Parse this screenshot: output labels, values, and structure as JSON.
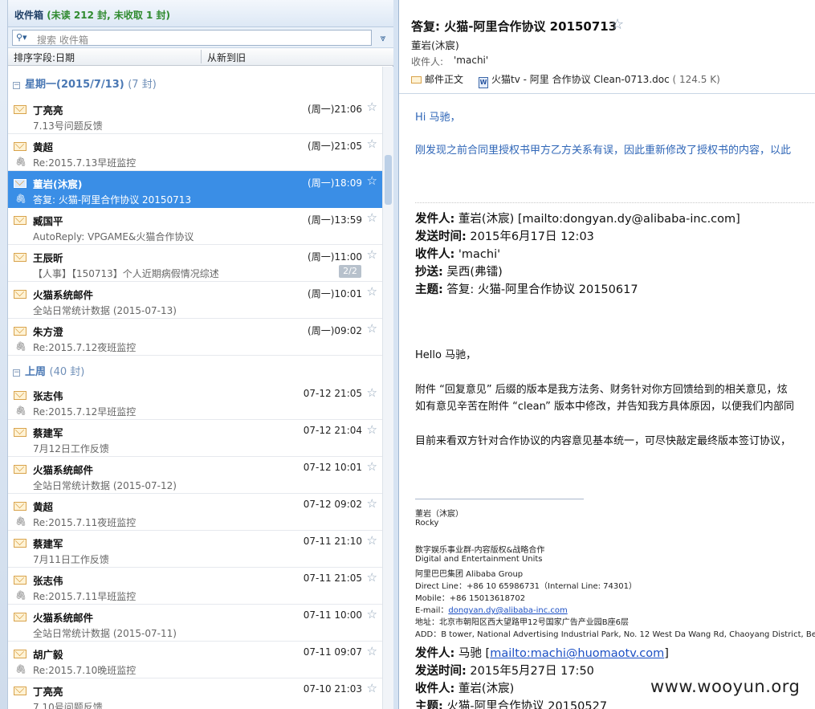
{
  "folder": {
    "title": "收件箱",
    "unread_label": "(未读 212 封,",
    "unreceived_label": "未收取 1 封)"
  },
  "search": {
    "placeholder": "搜索 收件箱",
    "icon": "search-icon"
  },
  "sort": {
    "field_label": "排序字段:日期",
    "order_label": "从新到旧"
  },
  "groups": [
    {
      "label": "星期一(2015/7/13)",
      "count": "(7 封)"
    },
    {
      "label": "上周",
      "count": "(40 封)"
    }
  ],
  "mails": [
    {
      "sender": "丁亮亮",
      "subject": "7.13号问题反馈",
      "time": "(周一)21:06",
      "attachment": false,
      "selected": false,
      "badge": ""
    },
    {
      "sender": "黄超",
      "subject": "Re:2015.7.13早班监控",
      "time": "(周一)21:05",
      "attachment": true,
      "selected": false,
      "badge": ""
    },
    {
      "sender": "董岩(沐宸)",
      "subject": "答复: 火猫-阿里合作协议 20150713",
      "time": "(周一)18:09",
      "attachment": true,
      "selected": true,
      "badge": ""
    },
    {
      "sender": "臧国平",
      "subject": "AutoReply:  VPGAME&火猫合作协议",
      "time": "(周一)13:59",
      "attachment": false,
      "selected": false,
      "badge": ""
    },
    {
      "sender": "王辰昕",
      "subject": "【人事】【150713】个人近期病假情况综述",
      "time": "(周一)11:00",
      "attachment": false,
      "selected": false,
      "badge": "2/2"
    },
    {
      "sender": "火猫系统邮件",
      "subject": "全站日常统计数据 (2015-07-13)",
      "time": "(周一)10:01",
      "attachment": false,
      "selected": false,
      "badge": ""
    },
    {
      "sender": "朱方澄",
      "subject": "Re:2015.7.12夜班监控",
      "time": "(周一)09:02",
      "attachment": true,
      "selected": false,
      "badge": ""
    },
    {
      "sender": "张志伟",
      "subject": "Re:2015.7.12早班监控",
      "time": "07-12 21:05",
      "attachment": true,
      "selected": false,
      "badge": ""
    },
    {
      "sender": "蔡建军",
      "subject": "7月12日工作反馈",
      "time": "07-12 21:04",
      "attachment": false,
      "selected": false,
      "badge": ""
    },
    {
      "sender": "火猫系统邮件",
      "subject": "全站日常统计数据 (2015-07-12)",
      "time": "07-12 10:01",
      "attachment": false,
      "selected": false,
      "badge": ""
    },
    {
      "sender": "黄超",
      "subject": "Re:2015.7.11夜班监控",
      "time": "07-12 09:02",
      "attachment": true,
      "selected": false,
      "badge": ""
    },
    {
      "sender": "蔡建军",
      "subject": "7月11日工作反馈",
      "time": "07-11 21:10",
      "attachment": false,
      "selected": false,
      "badge": ""
    },
    {
      "sender": "张志伟",
      "subject": "Re:2015.7.11早班监控",
      "time": "07-11 21:05",
      "attachment": true,
      "selected": false,
      "badge": ""
    },
    {
      "sender": "火猫系统邮件",
      "subject": "全站日常统计数据 (2015-07-11)",
      "time": "07-11 10:00",
      "attachment": false,
      "selected": false,
      "badge": ""
    },
    {
      "sender": "胡广毅",
      "subject": "Re:2015.7.10晚班监控",
      "time": "07-11 09:07",
      "attachment": true,
      "selected": false,
      "badge": ""
    },
    {
      "sender": "丁亮亮",
      "subject": "7.10号问题反馈",
      "time": "07-10 21:03",
      "attachment": false,
      "selected": false,
      "badge": ""
    }
  ],
  "message": {
    "subject": "答复: 火猫-阿里合作协议 20150713",
    "from": "董岩(沐宸)",
    "to_label": "收件人:",
    "to": "'machi'",
    "body_tab": "邮件正文",
    "attachment_name": "火猫tv - 阿里 合作协议 Clean-0713.doc",
    "attachment_size": "( 124.5 K)",
    "greeting": "Hi 马驰，",
    "intro": "刚发现之前合同里授权书甲方乙方关系有误，因此重新修改了授权书的内容，以此",
    "quoted1": {
      "from_label": "发件人:",
      "from": "董岩(沐宸) [mailto:dongyan.dy@alibaba-inc.com]",
      "sent_label": "发送时间:",
      "sent": "2015年6月17日 12:03",
      "to_label": "收件人:",
      "to": "'machi'",
      "cc_label": "抄送:",
      "cc": "吴西(弗镭)",
      "subj_label": "主题:",
      "subj": "答复: 火猫-阿里合作协议 20150617"
    },
    "hello": "Hello 马驰，",
    "para1": "附件 “回复意见” 后缀的版本是我方法务、财务针对你方回馈给到的相关意见，炫",
    "para2": "如有意见辛苦在附件 “clean” 版本中修改，并告知我方具体原因，以便我们内部同",
    "para3": "目前来看双方针对合作协议的内容意见基本统一，可尽快敲定最终版本签订协议，",
    "signature": [
      "董岩（沐宸）",
      "Rocky",
      "",
      "数字娱乐事业群-内容版权&战略合作",
      "Digital and Entertainment Units",
      "阿里巴巴集团 Alibaba Group",
      "Direct Line：+86 10 65986731（Internal Line: 74301）",
      "Mobile：+86 15013618702"
    ],
    "sig_email_label": "E-mail：",
    "sig_email": "dongyan.dy@alibaba-inc.com",
    "sig_addr_cn": "地址：北京市朝阳区西大望路甲12号国家广告产业园B座6层",
    "sig_addr_en": "ADD：B tower, National Advertising Industrial Park, No. 12 West Da Wang Rd, Chaoyang District, Beijin",
    "quoted2": {
      "from_label": "发件人:",
      "from": "马驰",
      "from_link": "mailto:machi@huomaotv.com",
      "sent_label": "发送时间:",
      "sent": "2015年5月27日 17:50",
      "to_label": "收件人:",
      "to": "董岩(沐宸)",
      "subj_label": "主题:",
      "subj": "火猫-阿里合作协议 20150527"
    }
  },
  "watermark": "www.wooyun.org",
  "colors": {
    "selection": "#3a8ee6",
    "group_header": "#4a78b4",
    "link": "#1b4fc4"
  }
}
